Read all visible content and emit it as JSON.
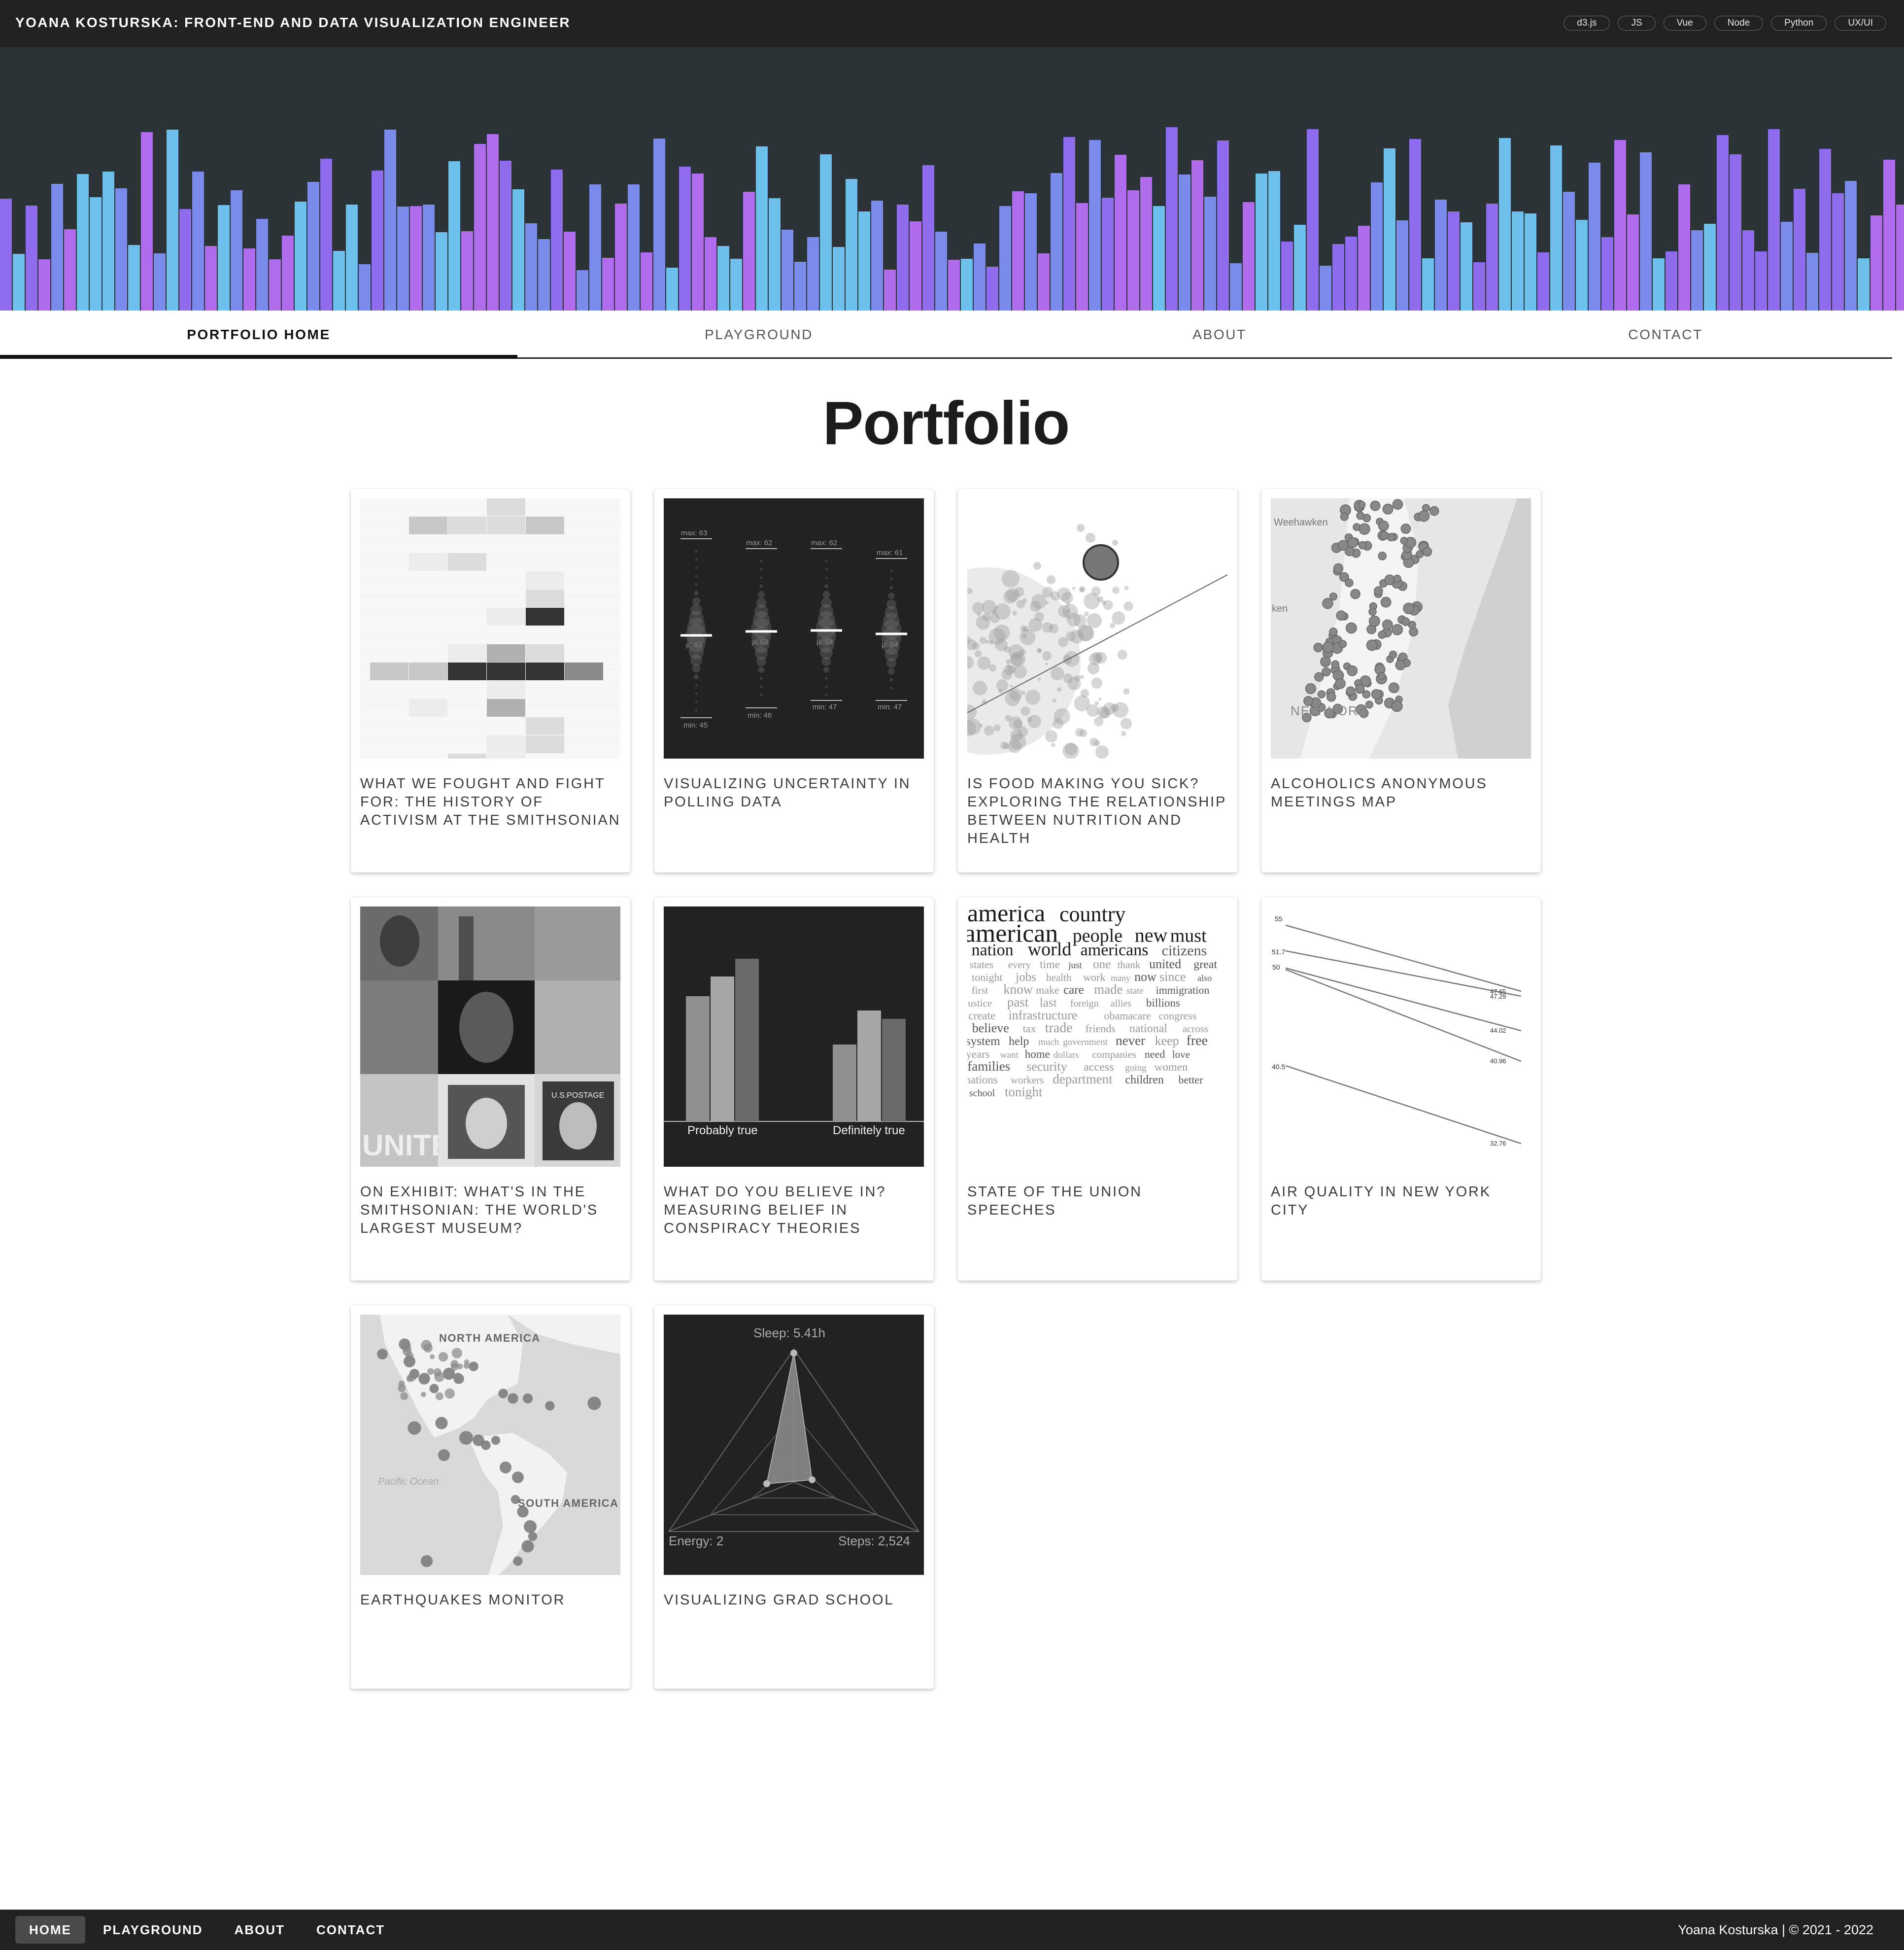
{
  "header": {
    "title": "YOANA KOSTURSKA: FRONT-END AND DATA VISUALIZATION ENGINEER",
    "chips": [
      "d3.js",
      "JS",
      "Vue",
      "Node",
      "Python",
      "UX/UI"
    ]
  },
  "banner": {
    "colors": [
      "#6ec0ec",
      "#7a8bec",
      "#8f6cec",
      "#b06cec"
    ]
  },
  "tabs": [
    "PORTFOLIO HOME",
    "PLAYGROUND",
    "ABOUT",
    "CONTACT"
  ],
  "page_title": "Portfolio",
  "projects": [
    {
      "title": "WHAT WE FOUGHT AND FIGHT FOR: THE HISTORY OF ACTIVISM AT THE SMITHSONIAN",
      "thumb": "heatmap"
    },
    {
      "title": "VISUALIZING UNCERTAINTY IN POLLING DATA",
      "thumb": "polling",
      "labels": {
        "max": [
          "max: 63",
          "max: 62",
          "max: 62",
          "max: 61"
        ],
        "min": [
          "min: 45",
          "min: 46",
          "min: 47",
          "min: 47"
        ],
        "mu": [
          "μ: 53",
          "μ: 53",
          "μ: 54",
          "μ: 54"
        ]
      }
    },
    {
      "title": "IS FOOD MAKING YOU SICK? EXPLORING THE RELATIONSHIP BETWEEN NUTRITION AND HEALTH",
      "thumb": "scatter"
    },
    {
      "title": "ALCOHOLICS ANONYMOUS MEETINGS MAP",
      "thumb": "nyc-map",
      "labels": {
        "place1": "Weehawken",
        "place2": "ken",
        "city": "NEW YORK"
      }
    },
    {
      "title": "ON EXHIBIT: WHAT'S IN THE SMITHSONIAN: THE WORLD'S LARGEST MUSEUM?",
      "thumb": "collage",
      "labels": {
        "stamp1": "UNITED",
        "stamp2": "U.S.POSTAGE"
      }
    },
    {
      "title": "WHAT DO YOU BELIEVE IN? MEASURING BELIEF IN CONSPIRACY THEORIES",
      "thumb": "belief-bars",
      "labels": {
        "left": "Probably true",
        "right": "Definitely true"
      }
    },
    {
      "title": "STATE OF THE UNION SPEECHES",
      "thumb": "wordcloud",
      "words": [
        "america",
        "country",
        "american",
        "people",
        "new",
        "must",
        "nation",
        "world",
        "americans",
        "citizens",
        "states",
        "every",
        "time",
        "just",
        "one",
        "thank",
        "united",
        "great",
        "tonight",
        "jobs",
        "health",
        "work",
        "many",
        "now",
        "since",
        "also",
        "first",
        "know",
        "make",
        "care",
        "made",
        "state",
        "immigration",
        "justice",
        "past",
        "last",
        "foreign",
        "allies",
        "billions",
        "create",
        "infrastructure",
        "obamacare",
        "congress",
        "believe",
        "tax",
        "trade",
        "friends",
        "national",
        "across",
        "system",
        "help",
        "much",
        "government",
        "never",
        "keep",
        "free",
        "years",
        "want",
        "home",
        "dollars",
        "companies",
        "need",
        "love",
        "families",
        "security",
        "access",
        "going",
        "women",
        "nations",
        "workers",
        "department",
        "children",
        "better",
        "school",
        "tonight"
      ]
    },
    {
      "title": "AIR QUALITY IN NEW YORK CITY",
      "thumb": "slope",
      "left_values": [
        "55",
        "51.7",
        "50",
        "40.5"
      ],
      "right_values": [
        "47.65",
        "47.29",
        "44.02",
        "40.96",
        "32.76"
      ]
    },
    {
      "title": "EARTHQUAKES MONITOR",
      "thumb": "quake-map",
      "labels": {
        "na": "NORTH AMERICA",
        "sa": "SOUTH AMERICA",
        "ocean": "Pacific Ocean"
      }
    },
    {
      "title": "VISUALIZING GRAD SCHOOL",
      "thumb": "radar",
      "labels": {
        "sleep": "Sleep: 5.41h",
        "energy": "Energy: 2",
        "steps": "Steps: 2,524"
      }
    }
  ],
  "footer": {
    "nav": [
      "HOME",
      "PLAYGROUND",
      "ABOUT",
      "CONTACT"
    ],
    "copyright": "Yoana Kosturska | © 2021 - 2022"
  }
}
